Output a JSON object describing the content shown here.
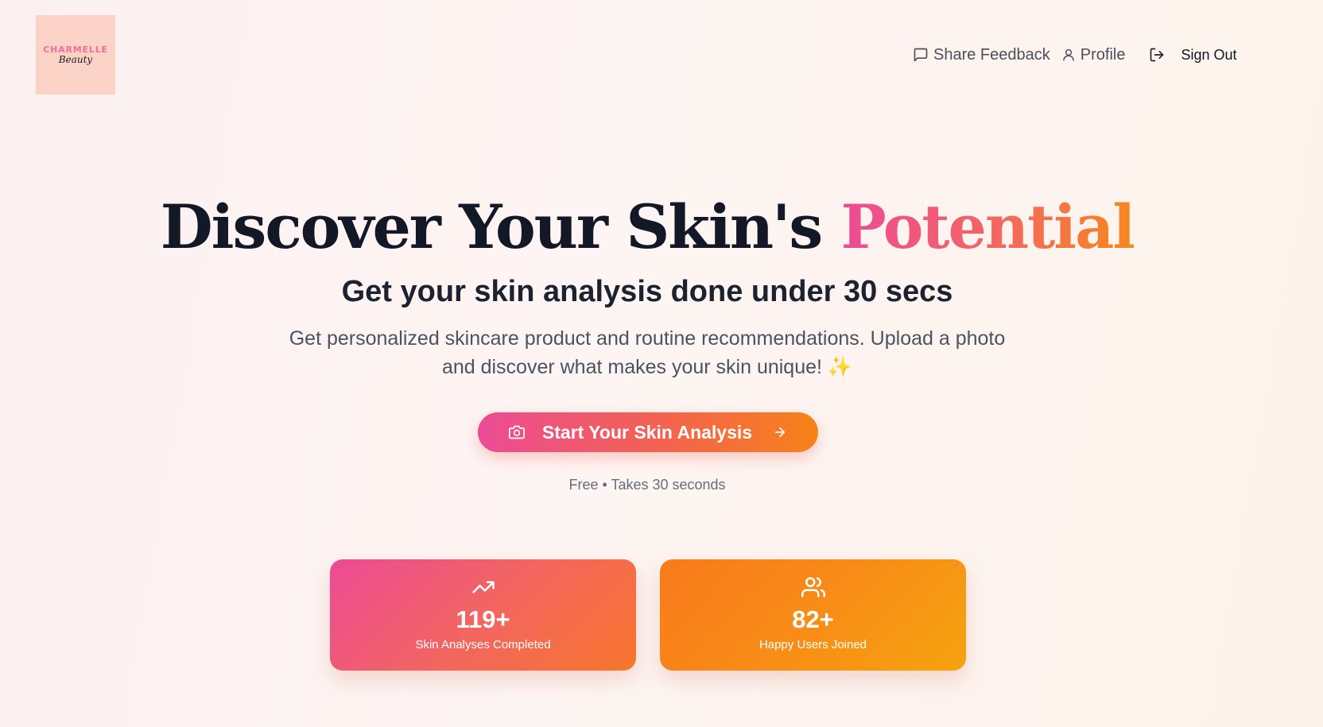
{
  "brand": {
    "logo_line1": "CHARMELLE",
    "logo_line2": "Beauty"
  },
  "nav": {
    "feedback_label": "Share Feedback",
    "profile_label": "Profile",
    "signout_label": "Sign Out"
  },
  "hero": {
    "title_main": "Discover Your Skin's",
    "title_accent": "Potential",
    "subtitle": "Get your skin analysis done under 30 secs",
    "description": "Get personalized skincare product and routine recommendations. Upload a photo and discover what makes your skin unique! ✨",
    "cta_label": "Start Your Skin Analysis",
    "cta_note": "Free • Takes 30 seconds"
  },
  "stats": [
    {
      "value": "119+",
      "label": "Skin Analyses Completed",
      "icon": "trending-up-icon"
    },
    {
      "value": "82+",
      "label": "Happy Users Joined",
      "icon": "users-icon"
    }
  ],
  "colors": {
    "pink": "#ec4b95",
    "orange": "#f78217",
    "amber": "#f5a30f",
    "logo_bg": "#fbd3c6",
    "heading": "#121826"
  }
}
